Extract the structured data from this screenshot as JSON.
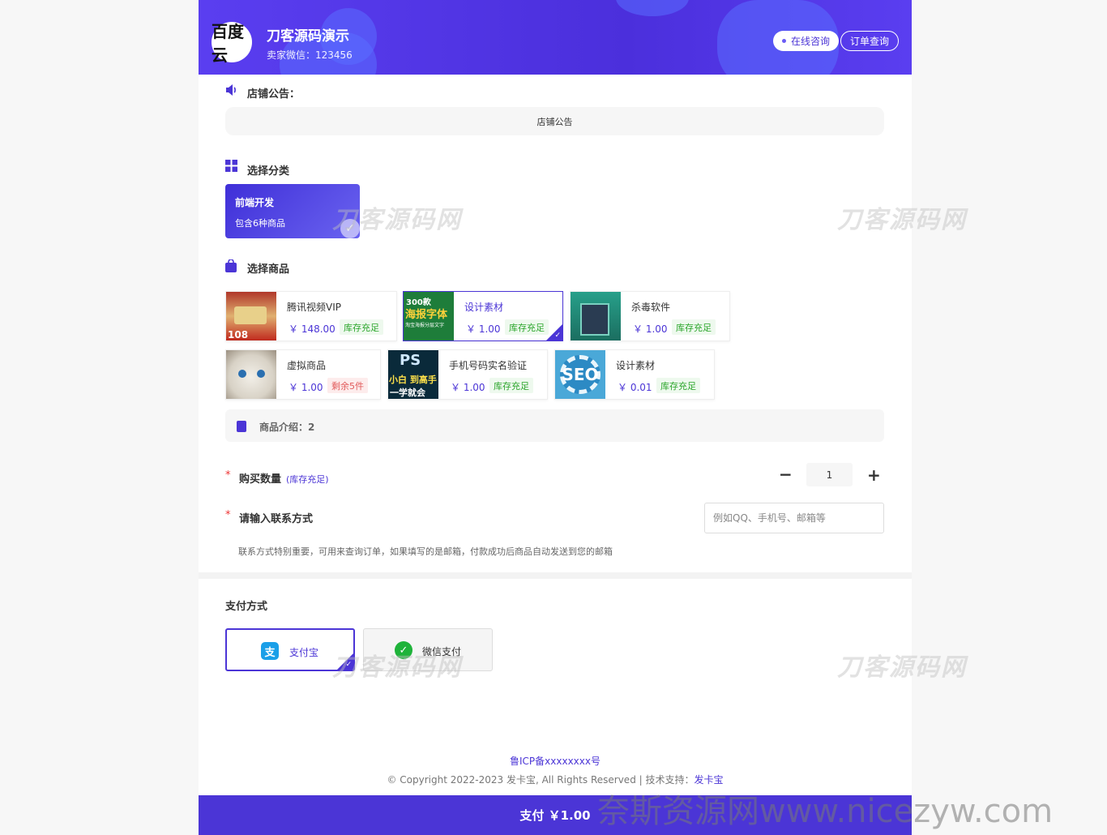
{
  "header": {
    "shop_name": "刀客源码演示",
    "seller_wechat": "卖家微信：123456",
    "avatar_text": "百度云",
    "online_btn": "在线咨询",
    "order_btn": "订单查询"
  },
  "notice": {
    "title": "店铺公告：",
    "content": "店铺公告"
  },
  "category": {
    "title": "选择分类",
    "items": [
      {
        "name": "前端开发",
        "count": "包含6种商品"
      }
    ]
  },
  "goods": {
    "title": "选择商品",
    "items": [
      {
        "name": "腾讯视频VIP",
        "price": "￥ 148.00",
        "stock": "库存充足"
      },
      {
        "name": "设计素材",
        "price": "￥ 1.00",
        "stock": "库存充足"
      },
      {
        "name": "杀毒软件",
        "price": "￥ 1.00",
        "stock": "库存充足"
      },
      {
        "name": "虚拟商品",
        "price": "￥ 1.00",
        "stock": "剩余5件"
      },
      {
        "name": "手机号码实名验证",
        "price": "￥ 1.00",
        "stock": "库存充足"
      },
      {
        "name": "设计素材",
        "price": "￥ 0.01",
        "stock": "库存充足"
      }
    ],
    "thumb_texts": {
      "poster_a": "300款",
      "poster_b": "海报字体",
      "poster_c": "淘宝海报分层文字",
      "ps_a": "PS",
      "ps_b": "小白 到高手",
      "ps_c": "一学就会",
      "seo": "SEO",
      "vip_num": "108"
    }
  },
  "intro": {
    "label": "商品介绍：2"
  },
  "quantity": {
    "label": "购买数量",
    "stock": "(库存充足)",
    "value": "1",
    "minus": "−",
    "plus": "+"
  },
  "contact": {
    "label": "请输入联系方式",
    "placeholder": "例如QQ、手机号、邮箱等",
    "hint": "联系方式特别重要，可用来查询订单，如果填写的是邮箱，付款成功后商品自动发送到您的邮箱"
  },
  "payment": {
    "title": "支付方式",
    "alipay": "支付宝",
    "wechat": "微信支付",
    "alipay_glyph": "支"
  },
  "footer": {
    "icp": "鲁ICP备xxxxxxxx号",
    "copy": "© Copyright 2022-2023 发卡宝, All Rights Reserved | 技术支持：",
    "support": "发卡宝"
  },
  "paybar": {
    "label": "支付 ￥1.00"
  },
  "watermarks": {
    "site": "刀客源码网",
    "bottom": "奈斯资源网www.nicezyw.com"
  },
  "colors": {
    "accent": "#4b35d6",
    "stock_ok": "#2aa52a",
    "stock_low": "#e15a5a"
  }
}
